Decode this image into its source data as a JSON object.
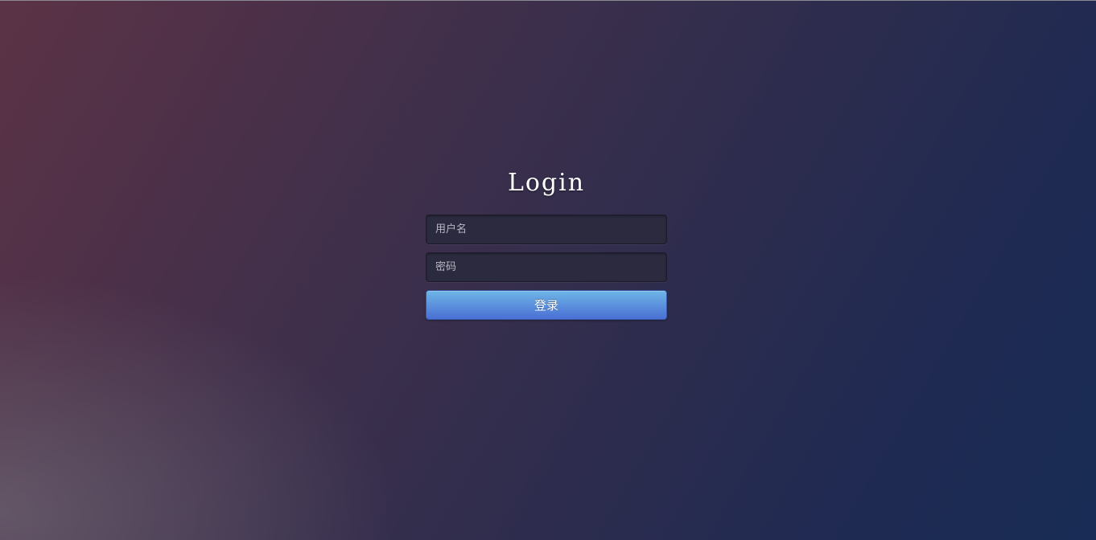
{
  "login": {
    "title": "Login",
    "username_placeholder": "用户名",
    "password_placeholder": "密码",
    "submit_label": "登录"
  },
  "colors": {
    "button_accent": "#5a8edc",
    "input_background": "#2b2a3f",
    "title_text": "#ffffff"
  }
}
